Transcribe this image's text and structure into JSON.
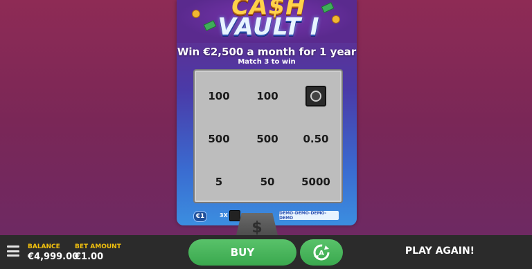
{
  "game": {
    "logo_line1": "CA$H",
    "logo_line2": "VAULT I",
    "headline": "Win €2,500 a month for 1 year",
    "subline": "Match 3 to win"
  },
  "grid": {
    "cells": [
      "100",
      "100",
      "vault-icon",
      "500",
      "500",
      "0.50",
      "5",
      "50",
      "5000"
    ]
  },
  "ticket_footer": {
    "price": "€1",
    "multiplier": "3X",
    "demo_text": "DEMO-DEMO-DEMO-DEMO"
  },
  "scratch_tab": {
    "icon": "dollar-icon",
    "symbol": "$"
  },
  "bottom_bar": {
    "balance_label": "BALANCE",
    "balance_value": "€4,999.00",
    "bet_label": "BET AMOUNT",
    "bet_value": "€1.00",
    "buy_label": "BUY",
    "autoplay_icon": "autoplay-icon",
    "play_again_label": "PLAY AGAIN!"
  },
  "colors": {
    "buy_green": "#3aa84e",
    "label_yellow": "#f4c20d",
    "bar_dark": "#2b2b2b"
  }
}
